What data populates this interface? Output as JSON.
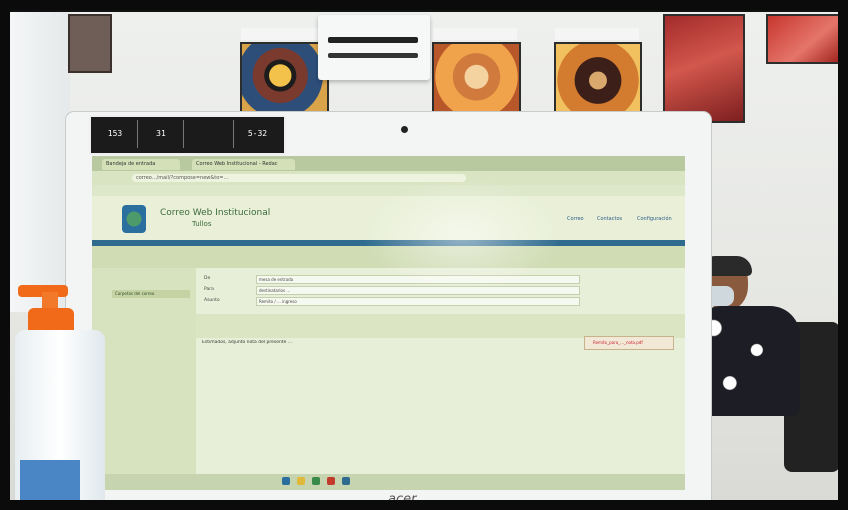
{
  "scene": {
    "monitor_brand": "acer"
  },
  "sticker": {
    "cells": [
      "153",
      "31",
      "",
      "5-32"
    ]
  },
  "browser": {
    "tabs": [
      "Correo Web Institucional - Redac",
      "Bandeja de entrada"
    ],
    "url": "correo.../mail/?compose=new&to=...",
    "site_title": "Correo Web Institucional",
    "site_subtitle": "Tullos",
    "nav_links": [
      "Correo",
      "Contactos",
      "Configuración"
    ]
  },
  "compose": {
    "field_labels": [
      "De",
      "Para",
      "Asunto"
    ],
    "field_values": [
      "mesa de entrada",
      "destinatarios ...",
      "Remito / ... ingreso"
    ],
    "sidebar_item": "Carpetas del correo",
    "body_text": "Estimados, adjunto nota del presente ...",
    "attachment_name": "Remito_para_..._nota.pdf"
  },
  "colors": {
    "screen_tint": "#e2ebc8",
    "brand_band": "#2f6b8e",
    "pump_orange": "#f06a1a"
  }
}
